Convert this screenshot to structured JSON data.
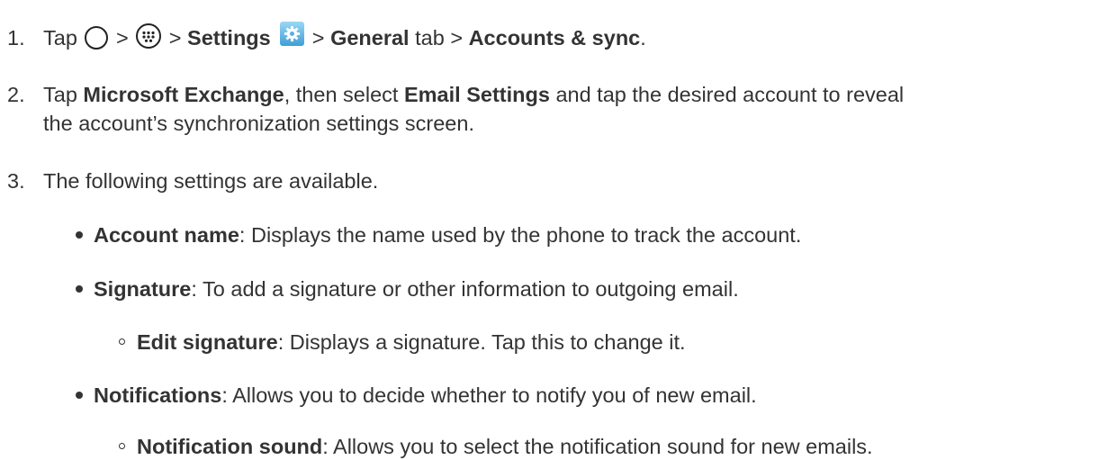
{
  "steps": [
    {
      "number": "1.",
      "tap": "Tap",
      "sep1": ">",
      "sep2": ">",
      "settings": "Settings",
      "sep3": ">",
      "general": "General",
      "tab_sep": "tab >",
      "accounts": "Accounts & sync",
      "end": ".",
      "icons": [
        "home-icon",
        "apps-icon",
        "settings-icon"
      ]
    },
    {
      "number": "2.",
      "tap": "Tap",
      "exchange": "Microsoft Exchange",
      "then": ", then select",
      "email_settings": "Email Settings",
      "rest": "and tap the desired account to reveal",
      "line2": "the account’s synchronization settings screen."
    },
    {
      "number": "3.",
      "text": "The following settings are available."
    }
  ],
  "bullets": [
    {
      "term": "Account name",
      "desc": ": Displays the name used by the phone to track the account."
    },
    {
      "term": "Signature",
      "desc": ": To add a signature or other information to outgoing email."
    },
    {
      "term": "Edit signature",
      "desc": ": Displays a signature. Tap this to change it."
    },
    {
      "term": "Notifications",
      "desc": ": Allows you to decide whether to notify you of new email."
    },
    {
      "term": "Notification sound",
      "desc": ": Allows you to select the notification sound for new emails."
    }
  ]
}
